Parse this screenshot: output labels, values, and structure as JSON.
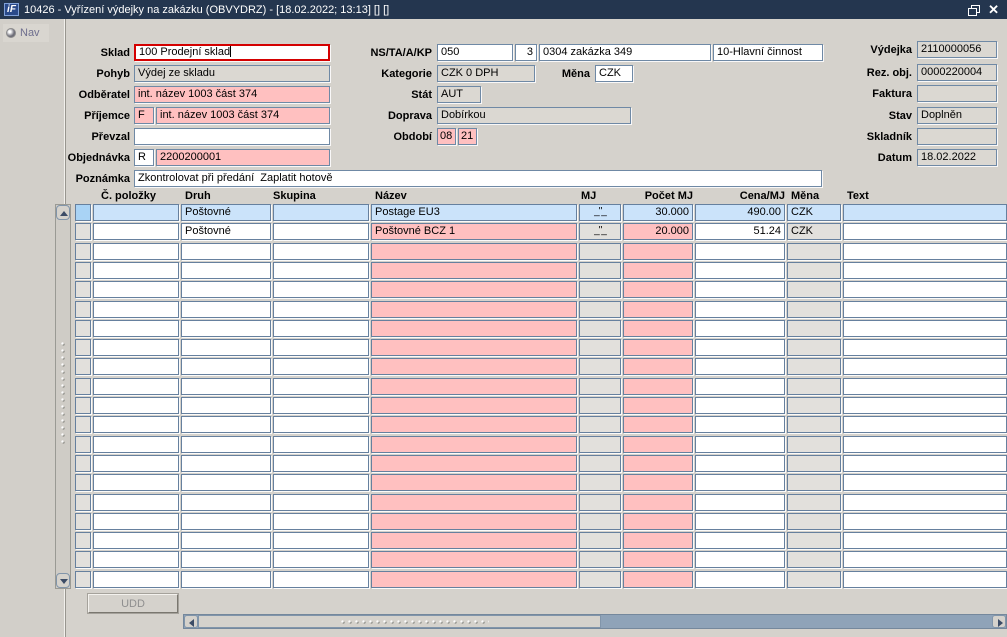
{
  "window": {
    "logo_text": "iF",
    "title": "10426 - Vyřízení výdejky na zakázku (OBVYDRZ) - [18.02.2022; 13:13]  []  []"
  },
  "nav": {
    "label": "Nav"
  },
  "form": {
    "sklad": {
      "label": "Sklad",
      "value": "100 Prodejní sklad"
    },
    "pohyb": {
      "label": "Pohyb",
      "value": "Výdej ze skladu"
    },
    "odberatel": {
      "label": "Odběratel",
      "value": "int. název 1003 část 374"
    },
    "prijemce": {
      "label": "Příjemce",
      "flag": "F",
      "value": "int. název 1003 část 374"
    },
    "prevzal": {
      "label": "Převzal",
      "value": ""
    },
    "objednavka": {
      "label": "Objednávka",
      "flag": "R",
      "value": "2200200001"
    },
    "poznamka": {
      "label": "Poznámka",
      "value": "Zkontrolovat při předání  Zaplatit hotově"
    },
    "nstaakp": {
      "label": "NS/TA/A/KP",
      "value1": "050",
      "value2": "3",
      "value3": "0304 zakázka 349",
      "value4": "10-Hlavní činnost"
    },
    "kategorie": {
      "label": "Kategorie",
      "value": "CZK 0 DPH"
    },
    "mena": {
      "label": "Měna",
      "value": "CZK"
    },
    "stat": {
      "label": "Stát",
      "value": "AUT"
    },
    "doprava": {
      "label": "Doprava",
      "value": "Dobírkou"
    },
    "obdobi": {
      "label": "Období",
      "value1": "08",
      "value2": "21"
    },
    "vydejka": {
      "label": "Výdejka",
      "value": "2110000056"
    },
    "rez_obj": {
      "label": "Rez. obj.",
      "value": "0000220004"
    },
    "faktura": {
      "label": "Faktura",
      "value": ""
    },
    "stav": {
      "label": "Stav",
      "value": "Doplněn"
    },
    "skladnik": {
      "label": "Skladník",
      "value": ""
    },
    "datum": {
      "label": "Datum",
      "value": "18.02.2022"
    }
  },
  "table": {
    "headers": [
      {
        "key": "cpolozky",
        "label": "Č. položky"
      },
      {
        "key": "druh",
        "label": "Druh"
      },
      {
        "key": "skupina",
        "label": "Skupina"
      },
      {
        "key": "nazev",
        "label": "Název"
      },
      {
        "key": "mj",
        "label": "MJ"
      },
      {
        "key": "pocet",
        "label": "Počet MJ",
        "align": "right"
      },
      {
        "key": "cena",
        "label": "Cena/MJ",
        "align": "right"
      },
      {
        "key": "mena",
        "label": "Měna"
      },
      {
        "key": "text",
        "label": "Text"
      }
    ],
    "empty_row_bg": {
      "cpolozky": "white",
      "druh": "white",
      "skupina": "white",
      "nazev": "pink",
      "mj": "gray",
      "pocet": "pink",
      "cena": "white",
      "mena": "gray",
      "text": "white"
    },
    "row_count": 20,
    "rows": [
      {
        "selected": true,
        "cells": {
          "cpolozky": "",
          "druh": "Poštovné",
          "skupina": "",
          "nazev": "Postage EU3",
          "mj": "_\"_",
          "pocet": "30.000",
          "cena": "490.00",
          "mena": "CZK",
          "text": ""
        }
      },
      {
        "selected": false,
        "cells": {
          "cpolozky": "",
          "druh": "Poštovné",
          "skupina": "",
          "nazev": "Poštovné BCZ 1",
          "mj": "_\"_",
          "pocet": "20.000",
          "cena": "51.24",
          "mena": "CZK",
          "text": ""
        }
      }
    ]
  },
  "footer": {
    "udd_label": "UDD"
  }
}
